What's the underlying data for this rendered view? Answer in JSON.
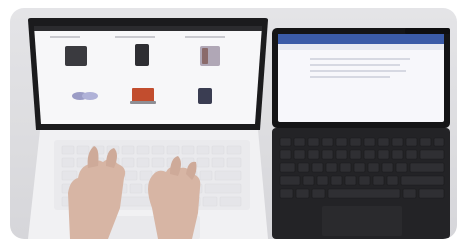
{
  "image": {
    "kind": "photo",
    "subject": [
      "laptop-screen-icon",
      "tablet-with-keyboard-icon",
      "hands-icon"
    ]
  },
  "colors": {
    "backdrop": "#dedee2",
    "laptop_body": "#f1f1f3",
    "laptop_bezel": "#1a1a1c",
    "tablet_body": "#232326",
    "tablet_screen": "#f7f7fb",
    "skin": "#d7b5a4"
  }
}
